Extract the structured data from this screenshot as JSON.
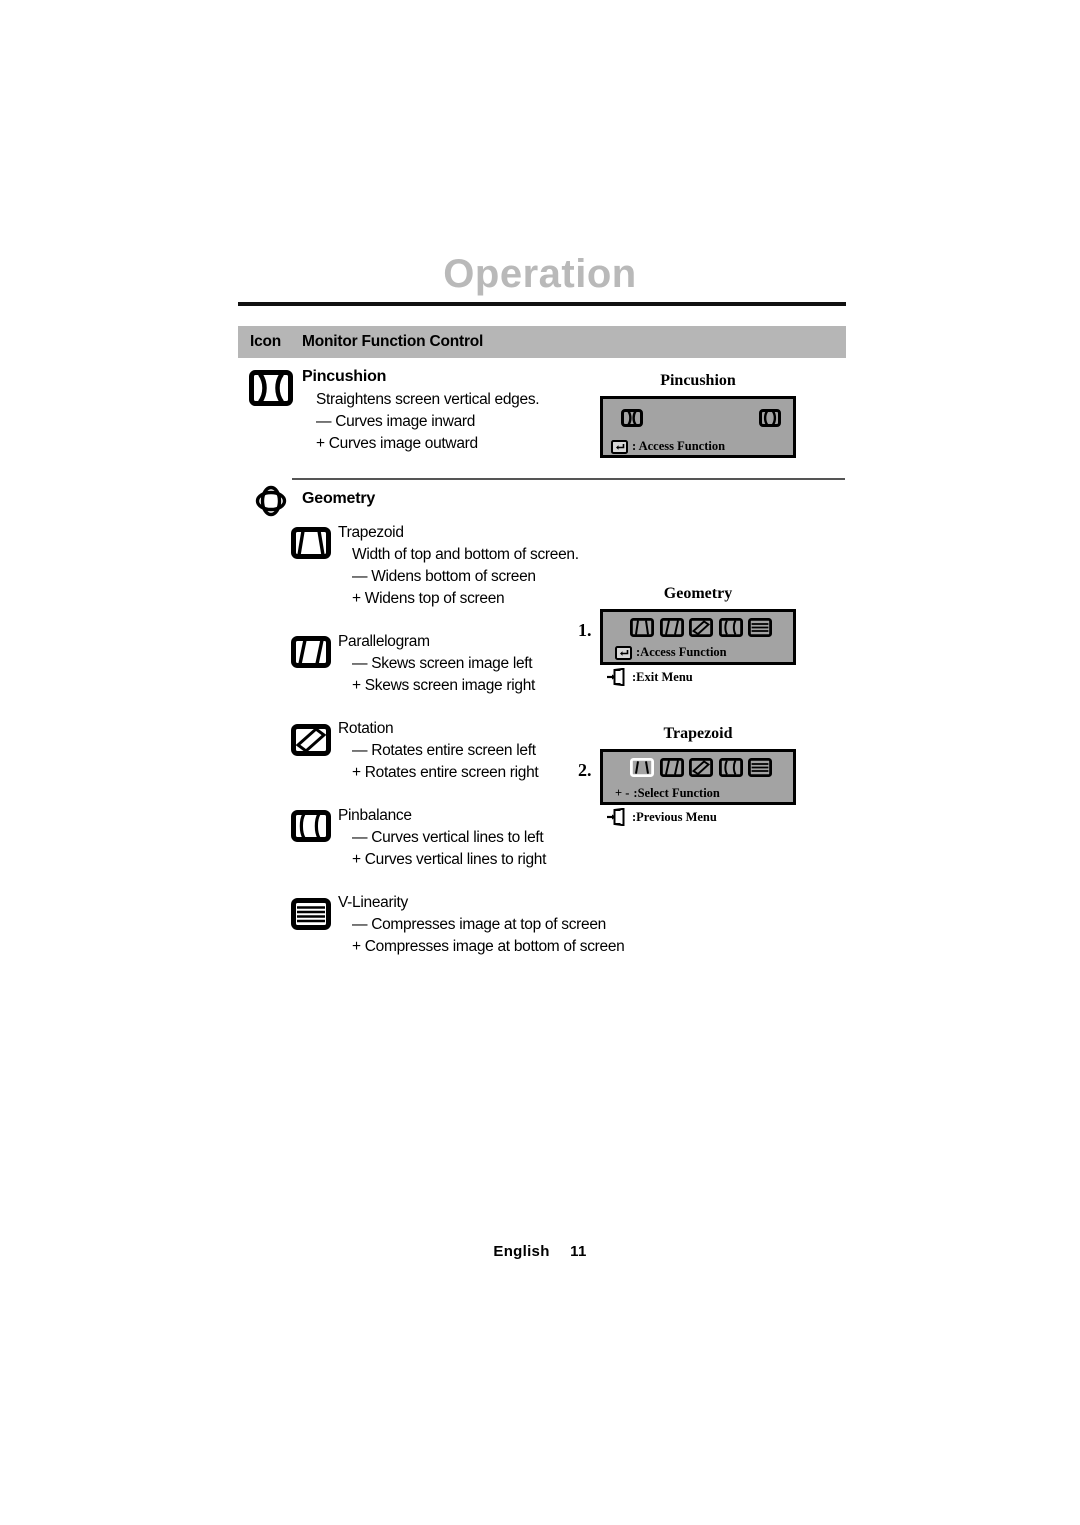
{
  "header": {
    "title": "Operation",
    "column_icon": "Icon",
    "column_function": "Monitor Function Control"
  },
  "sections": [
    {
      "name": "pincushion",
      "icon": "pincushion-icon",
      "title": "Pincushion",
      "description": "Straightens screen vertical edges.",
      "minus": "— Curves image inward",
      "plus": "+ Curves image outward"
    },
    {
      "name": "geometry",
      "icon": "geometry-icon",
      "title": "Geometry",
      "items": [
        {
          "name": "trapezoid",
          "icon": "trapezoid-icon",
          "title": "Trapezoid",
          "description": "Width of top and bottom of screen.",
          "minus": "—  Widens bottom of screen",
          "plus": "+  Widens top of screen"
        },
        {
          "name": "parallelogram",
          "icon": "parallelogram-icon",
          "title": "Parallelogram",
          "description": "",
          "minus": "—  Skews screen image left",
          "plus": "+  Skews screen image right"
        },
        {
          "name": "rotation",
          "icon": "rotation-icon",
          "title": "Rotation",
          "description": "",
          "minus": "—  Rotates entire screen left",
          "plus": "+  Rotates entire screen right"
        },
        {
          "name": "pinbalance",
          "icon": "pinbalance-icon",
          "title": "Pinbalance",
          "description": "",
          "minus": "— Curves vertical lines to left",
          "plus": "+ Curves vertical lines to right"
        },
        {
          "name": "v-linearity",
          "icon": "v-linearity-icon",
          "title": "V-Linearity",
          "description": "",
          "minus": "— Compresses image at top of screen",
          "plus": "+ Compresses image at bottom of screen"
        }
      ]
    }
  ],
  "osd": [
    {
      "name": "pincushion-osd",
      "caption": "Pincushion",
      "step": "",
      "hint_primary_icon": "enter-key-icon",
      "hint_primary": ": Access Function",
      "hint_secondary_icon": "",
      "hint_secondary": ""
    },
    {
      "name": "geometry-osd",
      "caption": "Geometry",
      "step": "1.",
      "hint_primary_icon": "enter-key-icon",
      "hint_primary": ":Access Function",
      "hint_secondary_icon": "exit-door-icon",
      "hint_secondary": ":Exit Menu"
    },
    {
      "name": "trapezoid-osd",
      "caption": "Trapezoid",
      "step": "2.",
      "hint_primary_icon": "plus-minus-icon",
      "hint_primary": ":Select Function",
      "hint_primary_prefix": "+ -",
      "hint_secondary_icon": "exit-door-icon",
      "hint_secondary": ":Previous Menu"
    }
  ],
  "footer": {
    "language": "English",
    "page_number": "11"
  },
  "colors": {
    "title_gray": "#b9b9b9",
    "header_bar": "#b6b6b6",
    "osd_background": "#a3a3a3",
    "rule": "#111111",
    "text": "#000000"
  }
}
